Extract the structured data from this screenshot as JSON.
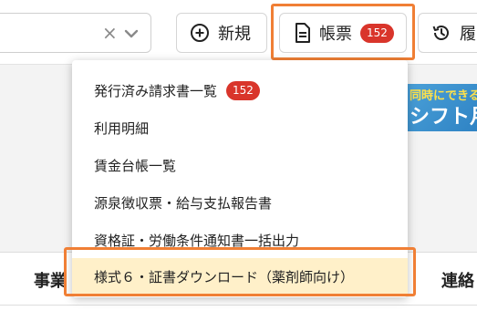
{
  "toolbar": {
    "select": {
      "clear_glyph": "×"
    },
    "new_button": {
      "label": "新規",
      "icon": "plus-circle-icon"
    },
    "report_button": {
      "label": "帳票",
      "badge": "152",
      "icon": "document-icon"
    },
    "history_button": {
      "label": "履",
      "icon": "history-icon"
    }
  },
  "banner": {
    "line1": "同時にできる",
    "line2": "シフト月"
  },
  "table": {
    "header_left": "事業",
    "header_right": "連絡"
  },
  "dropdown": {
    "items": [
      {
        "label": "発行済み請求書一覧",
        "badge": "152"
      },
      {
        "label": "利用明細"
      },
      {
        "label": "賃金台帳一覧"
      },
      {
        "label": "源泉徴収票・給与支払報告書"
      },
      {
        "label": "資格証・労働条件通知書一括出力"
      },
      {
        "label": "様式６・証書ダウンロード（薬剤師向け）",
        "selected": true
      }
    ]
  },
  "colors": {
    "accent_outline": "#f07f35",
    "badge": "#d9352b",
    "selected_bg": "#fff0c9"
  }
}
